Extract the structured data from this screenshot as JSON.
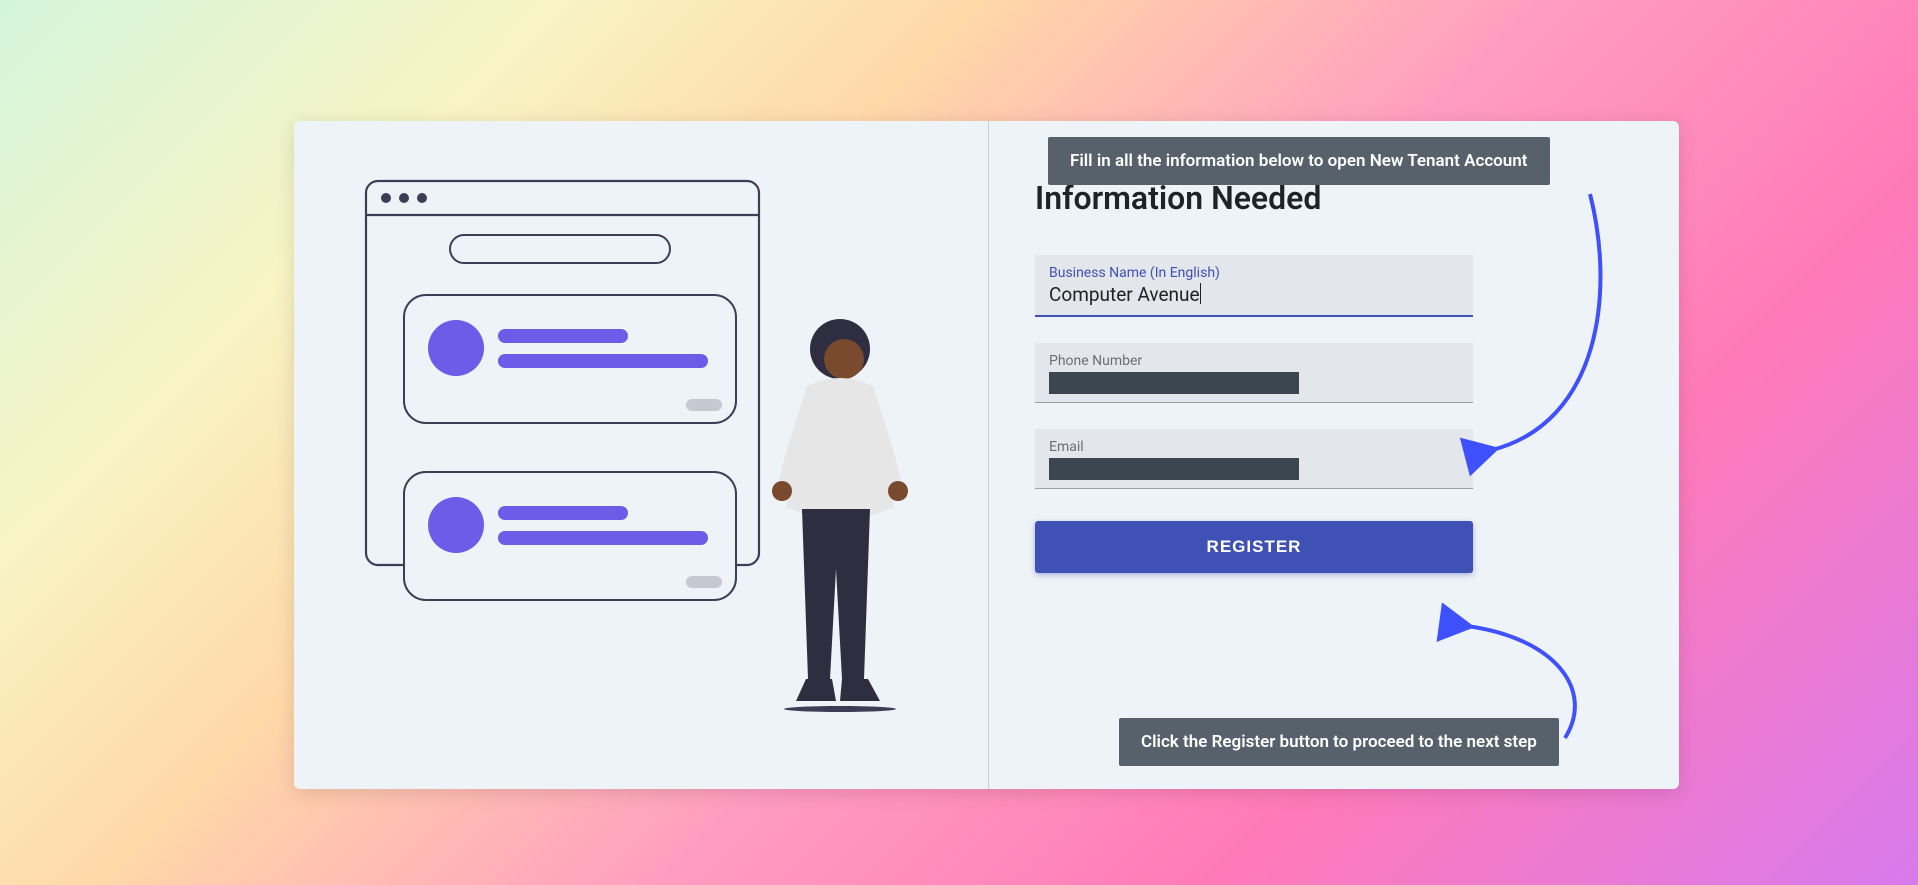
{
  "heading": "Information Needed",
  "form": {
    "business_name": {
      "label": "Business Name (In English)",
      "value": "Computer Avenue"
    },
    "phone": {
      "label": "Phone Number"
    },
    "email": {
      "label": "Email"
    },
    "register_label": "REGISTER"
  },
  "callouts": {
    "top": "Fill in all the information below to open New Tenant Account",
    "bottom": "Click the Register button to proceed to the next step"
  }
}
